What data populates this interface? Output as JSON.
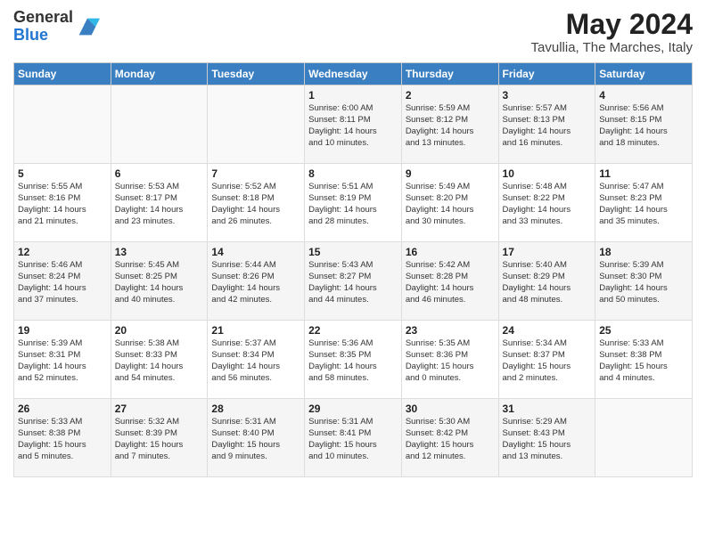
{
  "header": {
    "logo_general": "General",
    "logo_blue": "Blue",
    "month": "May 2024",
    "location": "Tavullia, The Marches, Italy"
  },
  "days_of_week": [
    "Sunday",
    "Monday",
    "Tuesday",
    "Wednesday",
    "Thursday",
    "Friday",
    "Saturday"
  ],
  "weeks": [
    [
      {
        "day": "",
        "info": ""
      },
      {
        "day": "",
        "info": ""
      },
      {
        "day": "",
        "info": ""
      },
      {
        "day": "1",
        "info": "Sunrise: 6:00 AM\nSunset: 8:11 PM\nDaylight: 14 hours\nand 10 minutes."
      },
      {
        "day": "2",
        "info": "Sunrise: 5:59 AM\nSunset: 8:12 PM\nDaylight: 14 hours\nand 13 minutes."
      },
      {
        "day": "3",
        "info": "Sunrise: 5:57 AM\nSunset: 8:13 PM\nDaylight: 14 hours\nand 16 minutes."
      },
      {
        "day": "4",
        "info": "Sunrise: 5:56 AM\nSunset: 8:15 PM\nDaylight: 14 hours\nand 18 minutes."
      }
    ],
    [
      {
        "day": "5",
        "info": "Sunrise: 5:55 AM\nSunset: 8:16 PM\nDaylight: 14 hours\nand 21 minutes."
      },
      {
        "day": "6",
        "info": "Sunrise: 5:53 AM\nSunset: 8:17 PM\nDaylight: 14 hours\nand 23 minutes."
      },
      {
        "day": "7",
        "info": "Sunrise: 5:52 AM\nSunset: 8:18 PM\nDaylight: 14 hours\nand 26 minutes."
      },
      {
        "day": "8",
        "info": "Sunrise: 5:51 AM\nSunset: 8:19 PM\nDaylight: 14 hours\nand 28 minutes."
      },
      {
        "day": "9",
        "info": "Sunrise: 5:49 AM\nSunset: 8:20 PM\nDaylight: 14 hours\nand 30 minutes."
      },
      {
        "day": "10",
        "info": "Sunrise: 5:48 AM\nSunset: 8:22 PM\nDaylight: 14 hours\nand 33 minutes."
      },
      {
        "day": "11",
        "info": "Sunrise: 5:47 AM\nSunset: 8:23 PM\nDaylight: 14 hours\nand 35 minutes."
      }
    ],
    [
      {
        "day": "12",
        "info": "Sunrise: 5:46 AM\nSunset: 8:24 PM\nDaylight: 14 hours\nand 37 minutes."
      },
      {
        "day": "13",
        "info": "Sunrise: 5:45 AM\nSunset: 8:25 PM\nDaylight: 14 hours\nand 40 minutes."
      },
      {
        "day": "14",
        "info": "Sunrise: 5:44 AM\nSunset: 8:26 PM\nDaylight: 14 hours\nand 42 minutes."
      },
      {
        "day": "15",
        "info": "Sunrise: 5:43 AM\nSunset: 8:27 PM\nDaylight: 14 hours\nand 44 minutes."
      },
      {
        "day": "16",
        "info": "Sunrise: 5:42 AM\nSunset: 8:28 PM\nDaylight: 14 hours\nand 46 minutes."
      },
      {
        "day": "17",
        "info": "Sunrise: 5:40 AM\nSunset: 8:29 PM\nDaylight: 14 hours\nand 48 minutes."
      },
      {
        "day": "18",
        "info": "Sunrise: 5:39 AM\nSunset: 8:30 PM\nDaylight: 14 hours\nand 50 minutes."
      }
    ],
    [
      {
        "day": "19",
        "info": "Sunrise: 5:39 AM\nSunset: 8:31 PM\nDaylight: 14 hours\nand 52 minutes."
      },
      {
        "day": "20",
        "info": "Sunrise: 5:38 AM\nSunset: 8:33 PM\nDaylight: 14 hours\nand 54 minutes."
      },
      {
        "day": "21",
        "info": "Sunrise: 5:37 AM\nSunset: 8:34 PM\nDaylight: 14 hours\nand 56 minutes."
      },
      {
        "day": "22",
        "info": "Sunrise: 5:36 AM\nSunset: 8:35 PM\nDaylight: 14 hours\nand 58 minutes."
      },
      {
        "day": "23",
        "info": "Sunrise: 5:35 AM\nSunset: 8:36 PM\nDaylight: 15 hours\nand 0 minutes."
      },
      {
        "day": "24",
        "info": "Sunrise: 5:34 AM\nSunset: 8:37 PM\nDaylight: 15 hours\nand 2 minutes."
      },
      {
        "day": "25",
        "info": "Sunrise: 5:33 AM\nSunset: 8:38 PM\nDaylight: 15 hours\nand 4 minutes."
      }
    ],
    [
      {
        "day": "26",
        "info": "Sunrise: 5:33 AM\nSunset: 8:38 PM\nDaylight: 15 hours\nand 5 minutes."
      },
      {
        "day": "27",
        "info": "Sunrise: 5:32 AM\nSunset: 8:39 PM\nDaylight: 15 hours\nand 7 minutes."
      },
      {
        "day": "28",
        "info": "Sunrise: 5:31 AM\nSunset: 8:40 PM\nDaylight: 15 hours\nand 9 minutes."
      },
      {
        "day": "29",
        "info": "Sunrise: 5:31 AM\nSunset: 8:41 PM\nDaylight: 15 hours\nand 10 minutes."
      },
      {
        "day": "30",
        "info": "Sunrise: 5:30 AM\nSunset: 8:42 PM\nDaylight: 15 hours\nand 12 minutes."
      },
      {
        "day": "31",
        "info": "Sunrise: 5:29 AM\nSunset: 8:43 PM\nDaylight: 15 hours\nand 13 minutes."
      },
      {
        "day": "",
        "info": ""
      }
    ]
  ]
}
